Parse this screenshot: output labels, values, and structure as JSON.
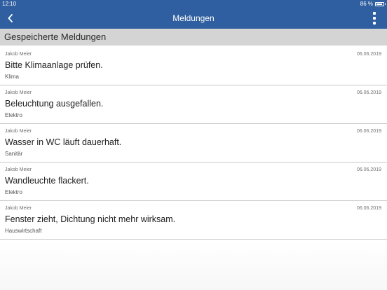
{
  "status_bar": {
    "time": "12:10",
    "battery_text": "86 %",
    "battery_level": 0.86
  },
  "nav": {
    "title": "Meldungen",
    "back_icon": "chevron-left-icon",
    "menu_icon": "vertical-dots-icon"
  },
  "section": {
    "title": "Gespeicherte Meldungen"
  },
  "items": [
    {
      "author": "Jakob Meier",
      "date": "06.06.2019",
      "title": "Bitte Klimaanlage prüfen.",
      "category": "Klima"
    },
    {
      "author": "Jakob Meier",
      "date": "06.06.2019",
      "title": "Beleuchtung ausgefallen.",
      "category": "Elektro"
    },
    {
      "author": "Jakob Meier",
      "date": "06.06.2019",
      "title": "Wasser in WC läuft dauerhaft.",
      "category": "Sanitär"
    },
    {
      "author": "Jakob Meier",
      "date": "06.06.2019",
      "title": "Wandleuchte flackert.",
      "category": "Elektro"
    },
    {
      "author": "Jakob Meier",
      "date": "06.06.2019",
      "title": "Fenster zieht, Dichtung nicht mehr wirksam.",
      "category": "Hauswirtschaft"
    }
  ],
  "colors": {
    "primary": "#2f5fa0",
    "section_bg": "#d4d4d4"
  }
}
